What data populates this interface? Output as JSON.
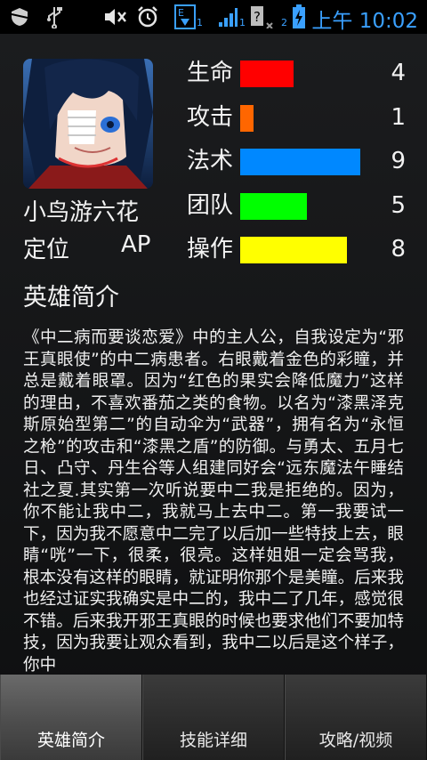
{
  "status_bar": {
    "time": "上午 10:02",
    "sub_1": "1",
    "sub_2": "1",
    "sub_3": "2"
  },
  "hero": {
    "name": "小鸟游六花",
    "role_label": "定位",
    "role_value": "AP",
    "stats": [
      {
        "label": "生命",
        "value": "4",
        "level": 4,
        "color": "#ff0000"
      },
      {
        "label": "攻击",
        "value": "1",
        "level": 1,
        "color": "#ff6600"
      },
      {
        "label": "法术",
        "value": "9",
        "level": 9,
        "color": "#0088ff"
      },
      {
        "label": "团队",
        "value": "5",
        "level": 5,
        "color": "#00ff00"
      },
      {
        "label": "操作",
        "value": "8",
        "level": 8,
        "color": "#ffff00"
      }
    ]
  },
  "section_title": "英雄简介",
  "intro": "《中二病而要谈恋爱》中的主人公，自我设定为“邪王真眼使”的中二病患者。右眼戴着金色的彩瞳，并总是戴着眼罩。因为“红色的果实会降低魔力”这样的理由，不喜欢番茄之类的食物。以名为“漆黑泽克斯原始型第二”的自动伞为“武器”，拥有名为“永恒之枪”的攻击和“漆黑之盾”的防御。与勇太、五月七日、凸守、丹生谷等人组建同好会“远东魔法午睡结社之夏.其实第一次听说要中二我是拒绝的。因为，你不能让我中二，我就马上去中二。第一我要试一下，因为我不愿意中二完了以后加一些特技上去，眼睛“咣”一下，很柔，很亮。这样姐姐一定会骂我，根本没有这样的眼睛，就证明你那个是美瞳。后来我也经过证实我确实是中二的，我中二了几年，感觉很不错。后来我开邪王真眼的时候也要求他们不要加特技，因为我要让观众看到，我中二以后是这个样子，你中",
  "tabs": [
    {
      "label": "英雄简介",
      "active": true
    },
    {
      "label": "技能详细",
      "active": false
    },
    {
      "label": "攻略/视频",
      "active": false
    }
  ]
}
